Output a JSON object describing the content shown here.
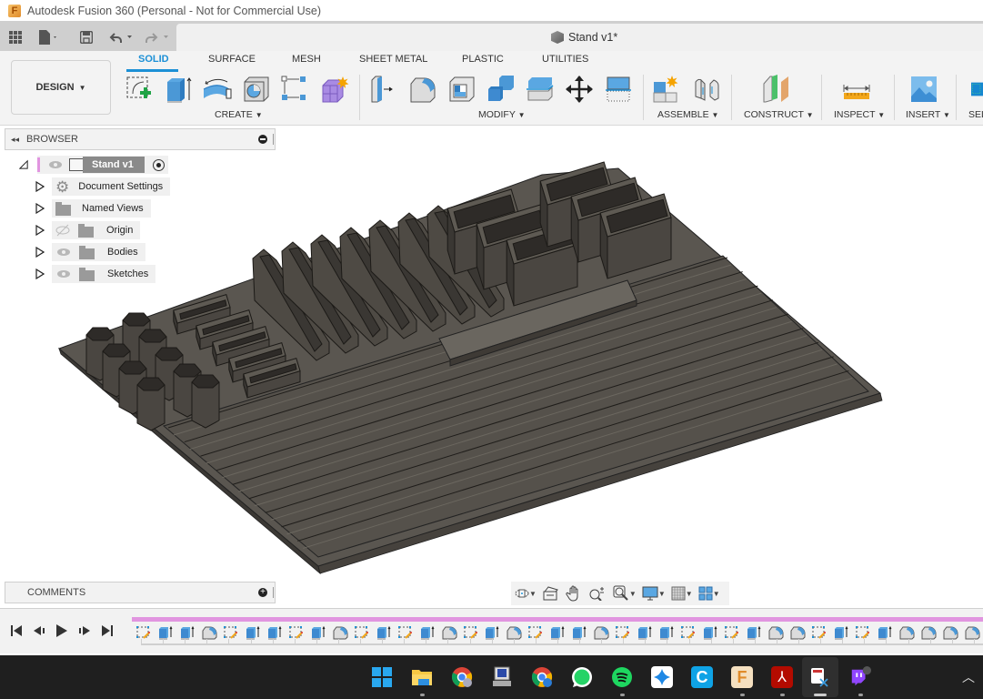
{
  "window": {
    "app_title": "Autodesk Fusion 360 (Personal - Not for Commercial Use)",
    "document_title": "Stand v1*"
  },
  "quick_access": {
    "icons": [
      "grid-menu-icon",
      "file-icon",
      "save-icon",
      "undo-icon",
      "redo-icon"
    ]
  },
  "toolbar": {
    "workspace_label": "DESIGN",
    "tabs": [
      {
        "label": "SOLID",
        "active": true
      },
      {
        "label": "SURFACE",
        "active": false
      },
      {
        "label": "MESH",
        "active": false
      },
      {
        "label": "SHEET METAL",
        "active": false
      },
      {
        "label": "PLASTIC",
        "active": false
      },
      {
        "label": "UTILITIES",
        "active": false
      }
    ],
    "groups": [
      {
        "label": "CREATE",
        "tools": [
          "create-sketch",
          "extrude",
          "revolve",
          "hole",
          "pattern",
          "create-form"
        ]
      },
      {
        "label": "MODIFY",
        "tools": [
          "press-pull",
          "fillet",
          "shell",
          "combine",
          "split-body",
          "move-copy",
          "offset-plane-align"
        ]
      },
      {
        "label": "ASSEMBLE",
        "tools": [
          "new-component",
          "joint"
        ]
      },
      {
        "label": "CONSTRUCT",
        "tools": [
          "offset-plane"
        ]
      },
      {
        "label": "INSPECT",
        "tools": [
          "measure"
        ]
      },
      {
        "label": "INSERT",
        "tools": [
          "insert-canvas"
        ]
      },
      {
        "label": "SEL",
        "tools": [
          "select"
        ]
      }
    ]
  },
  "browser": {
    "title": "BROWSER",
    "root": {
      "label": "Stand v1"
    },
    "items": [
      {
        "label": "Document Settings",
        "icon": "gear-icon",
        "visibility": "none"
      },
      {
        "label": "Named Views",
        "icon": "folder-icon",
        "visibility": "none"
      },
      {
        "label": "Origin",
        "icon": "folder-icon",
        "visibility": "hidden"
      },
      {
        "label": "Bodies",
        "icon": "folder-icon",
        "visibility": "visible"
      },
      {
        "label": "Sketches",
        "icon": "folder-icon",
        "visibility": "visible"
      }
    ]
  },
  "comments": {
    "title": "COMMENTS"
  },
  "nav_bar": {
    "icons": [
      "orbit-icon",
      "look-at-icon",
      "pan-icon",
      "zoom-icon",
      "fit-icon",
      "display-settings-icon",
      "grid-icon",
      "viewports-icon"
    ]
  },
  "timeline": {
    "controls": [
      "go-to-start",
      "step-back",
      "play",
      "step-forward",
      "go-to-end"
    ],
    "features": [
      "sketch",
      "extrude",
      "extrude",
      "fillet",
      "sketch",
      "extrude",
      "extrude",
      "sketch",
      "extrude",
      "fillet",
      "sketch",
      "extrude",
      "sketch",
      "extrude",
      "fillet",
      "sketch",
      "extrude",
      "fillet",
      "sketch",
      "extrude",
      "extrude",
      "fillet",
      "sketch",
      "extrude",
      "extrude",
      "sketch",
      "extrude",
      "sketch",
      "extrude",
      "fillet",
      "fillet",
      "sketch",
      "extrude",
      "sketch",
      "extrude",
      "fillet",
      "fillet",
      "fillet",
      "fillet"
    ]
  },
  "taskbar": {
    "apps": [
      "windows-start",
      "file-explorer",
      "chrome",
      "remote-desktop",
      "chrome-profile",
      "whatsapp",
      "spotify",
      "app-blue",
      "app-c",
      "fusion-360",
      "acrobat",
      "snipping-tool",
      "twitch"
    ],
    "tray": [
      "chevron-up-icon"
    ]
  },
  "colors": {
    "accent": "#1c90d6",
    "timeline_bar": "#e195e0",
    "model": "#5a5650"
  }
}
